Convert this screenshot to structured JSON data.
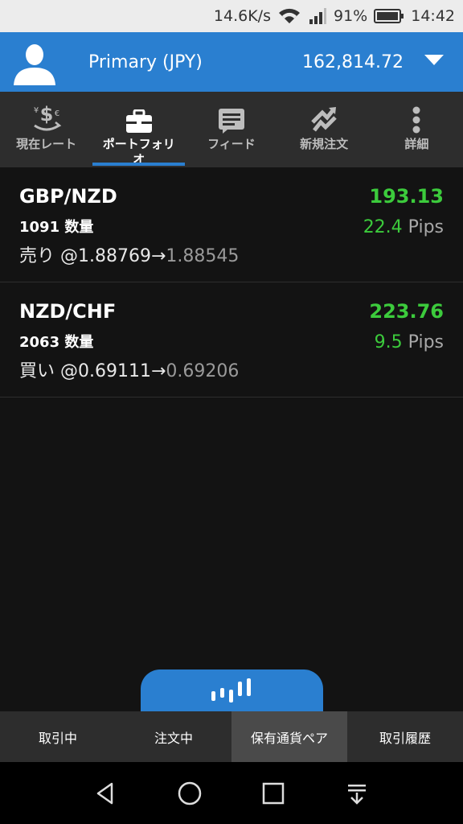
{
  "status_bar": {
    "net_speed": "14.6K/s",
    "battery": "91%",
    "time": "14:42",
    "icons": [
      "wifi-icon",
      "signal-icon",
      "battery-icon"
    ]
  },
  "account": {
    "name": "Primary (JPY)",
    "balance": "162,814.72"
  },
  "tabs": [
    {
      "label": "現在レート",
      "icon": "currency-exchange-icon"
    },
    {
      "label": "ポートフォリオ",
      "icon": "briefcase-icon",
      "active": true
    },
    {
      "label": "フィード",
      "icon": "feed-icon"
    },
    {
      "label": "新規注文",
      "icon": "new-order-icon"
    },
    {
      "label": "詳細",
      "icon": "more-vertical-icon"
    }
  ],
  "positions": [
    {
      "pair": "GBP/NZD",
      "quantity": "1091 数量",
      "side": "売り",
      "trade_prefix": "売り @1.88769→",
      "current_rate": "1.88545",
      "profit": "193.13",
      "pips_value": "22.4",
      "pips_unit": "Pips"
    },
    {
      "pair": "NZD/CHF",
      "quantity": "2063 数量",
      "side": "買い",
      "trade_prefix": "買い @0.69111→",
      "current_rate": "0.69206",
      "profit": "223.76",
      "pips_value": "9.5",
      "pips_unit": "Pips"
    }
  ],
  "bottom_tabs": [
    {
      "label": "取引中"
    },
    {
      "label": "注文中"
    },
    {
      "label": "保有通貨ペア",
      "active": true
    },
    {
      "label": "取引履歴"
    }
  ],
  "colors": {
    "accent": "#2a7fd0",
    "profit": "#3ccb3c",
    "background": "#131313",
    "tab_bar": "#2d2d2d"
  }
}
